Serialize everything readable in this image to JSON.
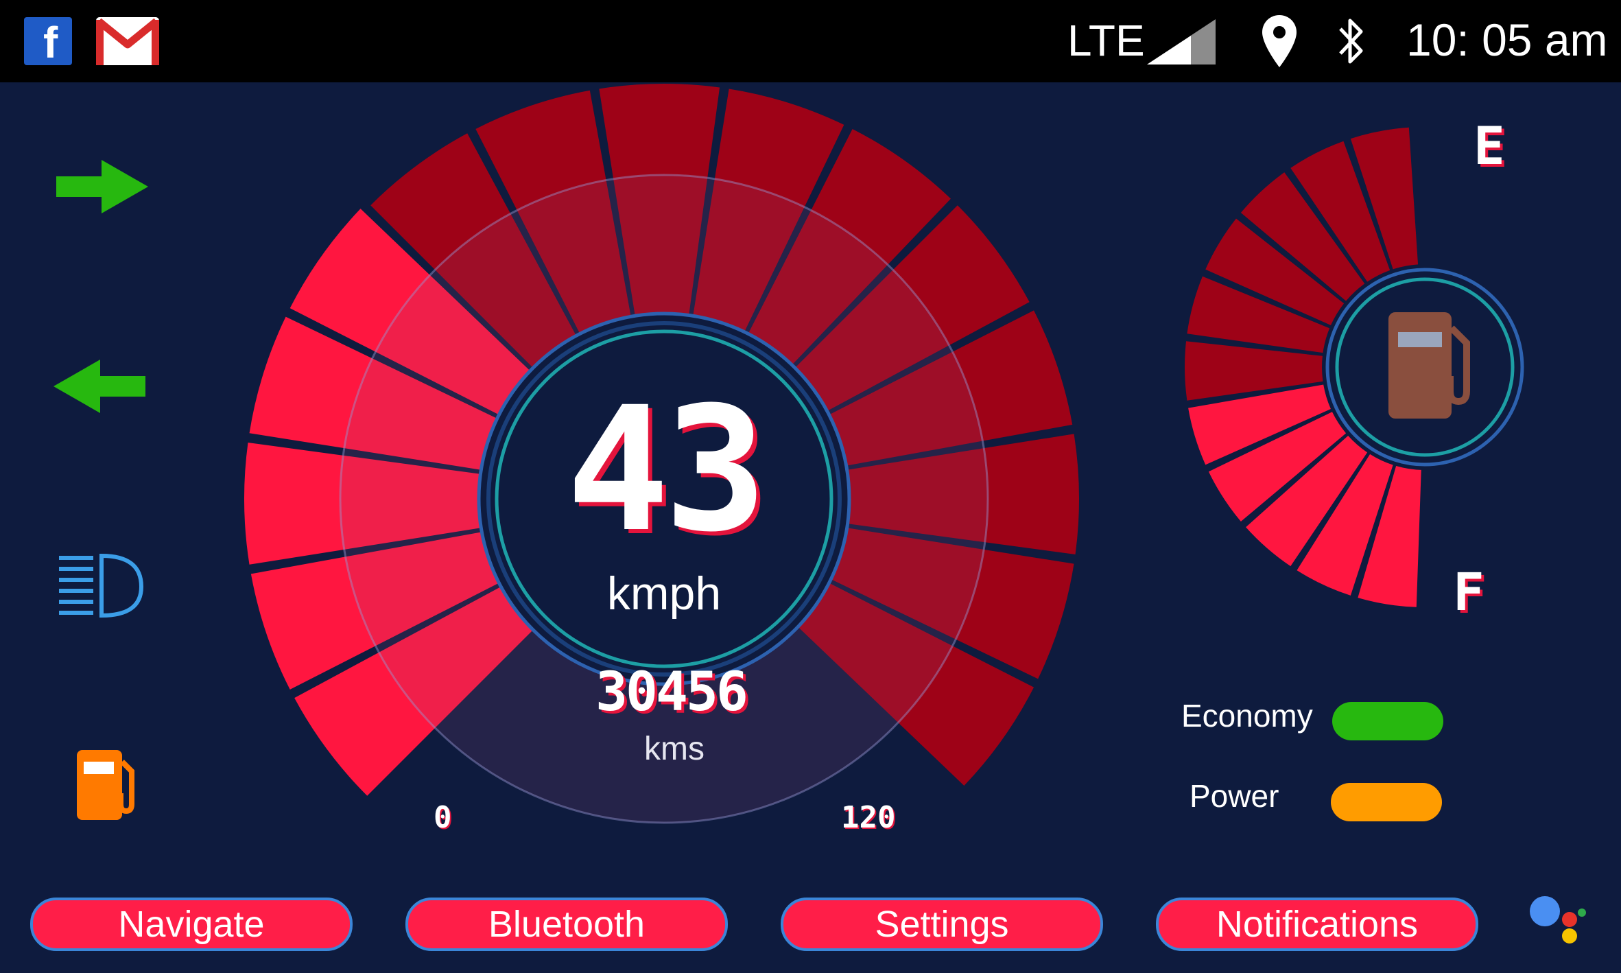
{
  "status_bar": {
    "app_icons": [
      "facebook-icon",
      "gmail-icon"
    ],
    "network": "LTE",
    "time": "10: 05 am",
    "icons": [
      "signal-icon",
      "location-icon",
      "bluetooth-icon"
    ]
  },
  "speedometer": {
    "speed": "43",
    "speed_unit": "kmph",
    "odometer": "30456",
    "odometer_unit": "kms",
    "scale_min": "0",
    "scale_max": "120",
    "speed_fraction": 0.36
  },
  "fuel_gauge": {
    "empty_label": "E",
    "full_label": "F",
    "icon": "fuel-pump-icon",
    "level_fraction": 0.45
  },
  "indicators": [
    "right-turn-arrow-icon",
    "left-turn-arrow-icon",
    "high-beam-headlight-icon",
    "low-fuel-icon"
  ],
  "legend": {
    "items": [
      {
        "label": "Economy",
        "color": "#27b80f"
      },
      {
        "label": "Power",
        "color": "#ff9c00"
      }
    ]
  },
  "nav_buttons": {
    "navigate": "Navigate",
    "bluetooth": "Bluetooth",
    "settings": "Settings",
    "notifications": "Notifications"
  },
  "assistant_icon": "google-assistant-icon",
  "colors": {
    "background": "#0e1b3e",
    "active_segment": "#ff1640",
    "inactive_segment": "#9e0217",
    "ring": "#1d9fa5",
    "button": "#ff1e48"
  }
}
